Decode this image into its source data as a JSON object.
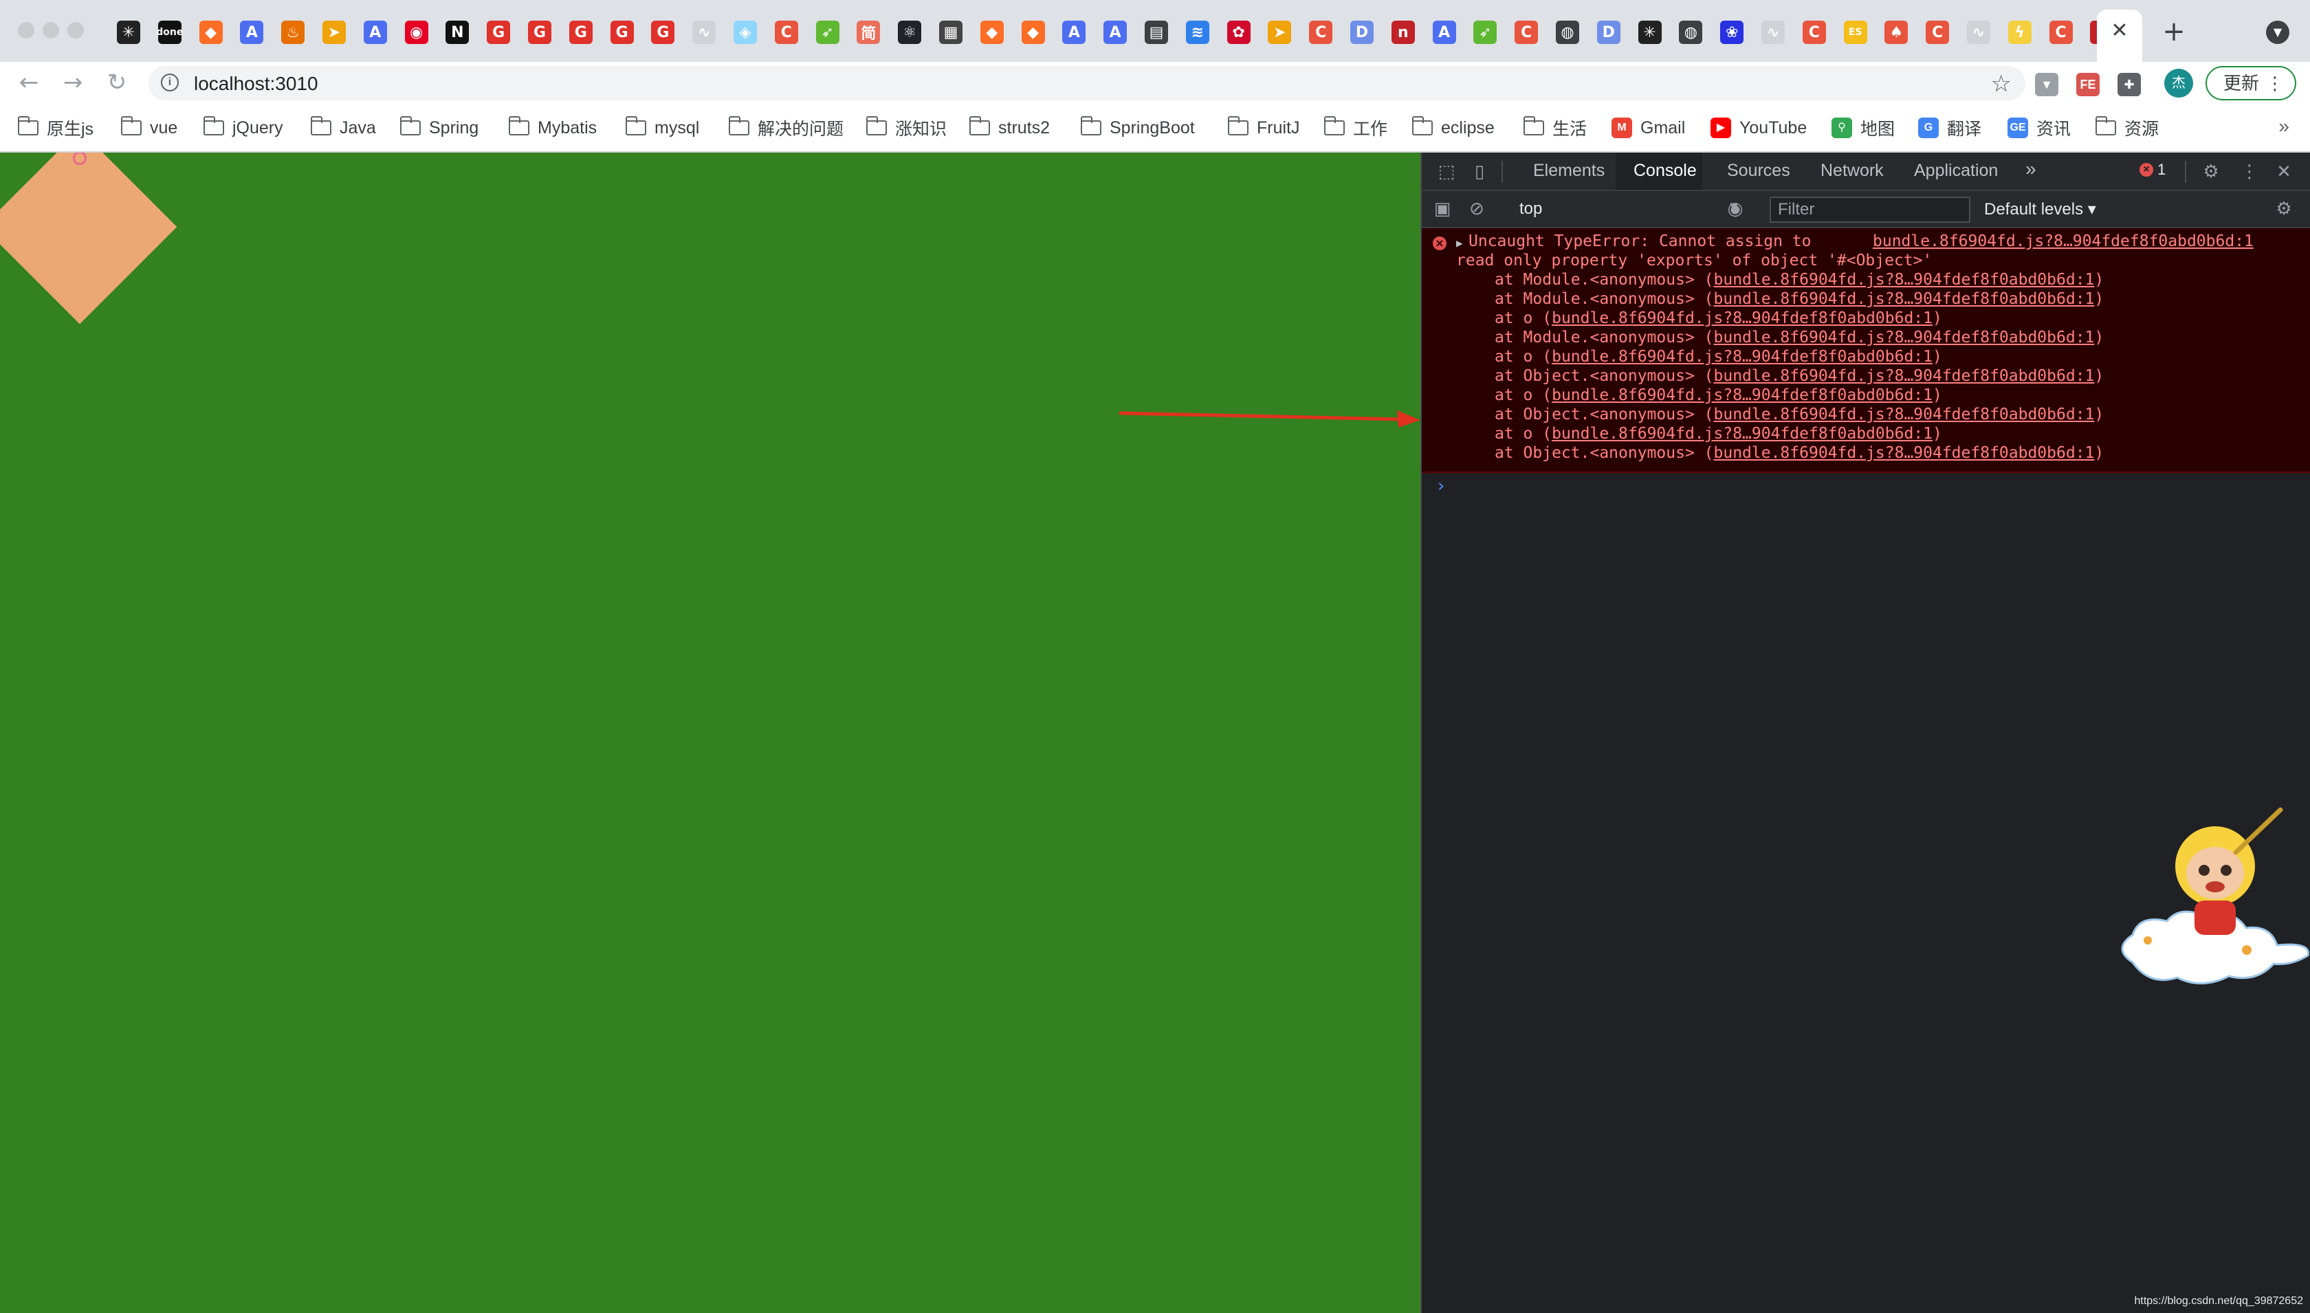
{
  "browser": {
    "url": "localhost:3010",
    "update_label": "更新",
    "avatar_label": "杰",
    "tab_close_glyph": "✕",
    "new_tab_glyph": "+",
    "tabs": [
      {
        "icon": "sunburst-icon",
        "glyph": "✳",
        "bg": "#222222"
      },
      {
        "icon": "done-icon",
        "glyph": "done",
        "bg": "#111111"
      },
      {
        "icon": "gitlab-icon",
        "glyph": "◆",
        "bg": "#fc6d26"
      },
      {
        "icon": "a-letter-icon",
        "glyph": "A",
        "bg": "#4e6ef2"
      },
      {
        "icon": "java-icon",
        "glyph": "♨",
        "bg": "#e76f00"
      },
      {
        "icon": "leaf-icon",
        "glyph": "➤",
        "bg": "#f0a30a"
      },
      {
        "icon": "a-letter-icon",
        "glyph": "A",
        "bg": "#4e6ef2"
      },
      {
        "icon": "netease-icon",
        "glyph": "◉",
        "bg": "#e60026"
      },
      {
        "icon": "n-letter-icon",
        "glyph": "N",
        "bg": "#111111"
      },
      {
        "icon": "g-icon",
        "glyph": "G",
        "bg": "#e0312b"
      },
      {
        "icon": "g-icon",
        "glyph": "G",
        "bg": "#e0312b"
      },
      {
        "icon": "g-icon",
        "glyph": "G",
        "bg": "#e0312b"
      },
      {
        "icon": "g-icon",
        "glyph": "G",
        "bg": "#e0312b"
      },
      {
        "icon": "g-icon",
        "glyph": "G",
        "bg": "#e0312b"
      },
      {
        "icon": "bird-icon",
        "glyph": "∿",
        "bg": "#cfd2d6"
      },
      {
        "icon": "webpack-icon",
        "glyph": "◈",
        "bg": "#8ed6fb"
      },
      {
        "icon": "c-letter-icon",
        "glyph": "C",
        "bg": "#e8543e"
      },
      {
        "icon": "leaf-icon",
        "glyph": "➶",
        "bg": "#5fb832"
      },
      {
        "icon": "jianshu-icon",
        "glyph": "简",
        "bg": "#ea6f5a"
      },
      {
        "icon": "react-icon",
        "glyph": "⚛",
        "bg": "#20232a"
      },
      {
        "icon": "grid-icon",
        "glyph": "▦",
        "bg": "#444444"
      },
      {
        "icon": "gitlab-icon",
        "glyph": "◆",
        "bg": "#fc6d26"
      },
      {
        "icon": "gitlab-icon",
        "glyph": "◆",
        "bg": "#fc6d26"
      },
      {
        "icon": "a-letter-icon",
        "glyph": "A",
        "bg": "#4e6ef2"
      },
      {
        "icon": "a-letter-icon",
        "glyph": "A",
        "bg": "#4e6ef2"
      },
      {
        "icon": "doc-icon",
        "glyph": "▤",
        "bg": "#3c4043"
      },
      {
        "icon": "layers-icon",
        "glyph": "≋",
        "bg": "#2f80ed"
      },
      {
        "icon": "huawei-icon",
        "glyph": "✿",
        "bg": "#cf0a2c"
      },
      {
        "icon": "leaf-icon",
        "glyph": "➤",
        "bg": "#f0a30a"
      },
      {
        "icon": "c-letter-icon",
        "glyph": "C",
        "bg": "#e8543e"
      },
      {
        "icon": "d-letter-icon",
        "glyph": "D",
        "bg": "#6f8ee8"
      },
      {
        "icon": "n-letter-icon",
        "glyph": "n",
        "bg": "#c12127"
      },
      {
        "icon": "a-letter-icon",
        "glyph": "A",
        "bg": "#4e6ef2"
      },
      {
        "icon": "leaf-icon",
        "glyph": "➶",
        "bg": "#5fb832"
      },
      {
        "icon": "c-letter-icon",
        "glyph": "C",
        "bg": "#e8543e"
      },
      {
        "icon": "globe-icon",
        "glyph": "◍",
        "bg": "#3c4043"
      },
      {
        "icon": "d-letter-icon",
        "glyph": "D",
        "bg": "#6f8ee8"
      },
      {
        "icon": "sunburst-icon",
        "glyph": "✳",
        "bg": "#222222"
      },
      {
        "icon": "globe-icon",
        "glyph": "◍",
        "bg": "#3c4043"
      },
      {
        "icon": "paw-icon",
        "glyph": "❀",
        "bg": "#2932e1"
      },
      {
        "icon": "bird-icon",
        "glyph": "∿",
        "bg": "#cfd2d6"
      },
      {
        "icon": "c-letter-icon",
        "glyph": "C",
        "bg": "#e8543e"
      },
      {
        "icon": "es-icon",
        "glyph": "ES",
        "bg": "#f4bd19"
      },
      {
        "icon": "fire-icon",
        "glyph": "♠",
        "bg": "#e8543e"
      },
      {
        "icon": "c-letter-icon",
        "glyph": "C",
        "bg": "#e8543e"
      },
      {
        "icon": "bird-icon",
        "glyph": "∿",
        "bg": "#cfd2d6"
      },
      {
        "icon": "bolt-icon",
        "glyph": "ϟ",
        "bg": "#f4d03f"
      },
      {
        "icon": "c-letter-icon",
        "glyph": "C",
        "bg": "#e8543e"
      },
      {
        "icon": "n-letter-icon",
        "glyph": "n",
        "bg": "#c12127"
      }
    ],
    "extensions": [
      {
        "icon": "vue-devtools-icon",
        "glyph": "▼",
        "bg": "#9aa0a6"
      },
      {
        "icon": "fe-helper-icon",
        "glyph": "FE",
        "bg": "#d9534f"
      },
      {
        "icon": "puzzle-icon",
        "glyph": "✚",
        "bg": "#5f6368"
      }
    ]
  },
  "bookmarks": [
    {
      "label": "原生js",
      "type": "folder"
    },
    {
      "label": "vue",
      "type": "folder"
    },
    {
      "label": "jQuery",
      "type": "folder"
    },
    {
      "label": "Java",
      "type": "folder"
    },
    {
      "label": "Spring",
      "type": "folder"
    },
    {
      "label": "Mybatis",
      "type": "folder"
    },
    {
      "label": "mysql",
      "type": "folder"
    },
    {
      "label": "解决的问题",
      "type": "folder"
    },
    {
      "label": "涨知识",
      "type": "folder"
    },
    {
      "label": "struts2",
      "type": "folder"
    },
    {
      "label": "SpringBoot",
      "type": "folder"
    },
    {
      "label": "FruitJ",
      "type": "folder"
    },
    {
      "label": "工作",
      "type": "folder"
    },
    {
      "label": "eclipse",
      "type": "folder"
    },
    {
      "label": "生活",
      "type": "folder"
    },
    {
      "label": "Gmail",
      "type": "site",
      "icon": "gmail-icon",
      "glyph": "M",
      "bg": "#ea4335"
    },
    {
      "label": "YouTube",
      "type": "site",
      "icon": "youtube-icon",
      "glyph": "▶",
      "bg": "#ff0000"
    },
    {
      "label": "地图",
      "type": "site",
      "icon": "maps-icon",
      "glyph": "⚲",
      "bg": "#34a853"
    },
    {
      "label": "翻译",
      "type": "site",
      "icon": "translate-icon",
      "glyph": "G",
      "bg": "#4285f4"
    },
    {
      "label": "资讯",
      "type": "site",
      "icon": "news-icon",
      "glyph": "GE",
      "bg": "#4285f4"
    },
    {
      "label": "资源",
      "type": "folder"
    }
  ],
  "bookmarks_more": "»",
  "devtools": {
    "tabs": [
      "Elements",
      "Console",
      "Sources",
      "Network",
      "Application"
    ],
    "active_tab": "Console",
    "more_tabs": "»",
    "error_count": "1",
    "context": "top",
    "filter_placeholder": "Filter",
    "levels": "Default levels ▾",
    "error": {
      "message_line1": "Uncaught TypeError: Cannot assign to",
      "message_line2": "read only property 'exports' of object '#<Object>'",
      "source": "bundle.8f6904fd.js?8…904fdef8f0abd0b6d:1",
      "stack": [
        {
          "prefix": "at Module.<anonymous> (",
          "link": "bundle.8f6904fd.js?8…904fdef8f0abd0b6d:1",
          "suffix": ")"
        },
        {
          "prefix": "at Module.<anonymous> (",
          "link": "bundle.8f6904fd.js?8…904fdef8f0abd0b6d:1",
          "suffix": ")"
        },
        {
          "prefix": "at o (",
          "link": "bundle.8f6904fd.js?8…904fdef8f0abd0b6d:1",
          "suffix": ")"
        },
        {
          "prefix": "at Module.<anonymous> (",
          "link": "bundle.8f6904fd.js?8…904fdef8f0abd0b6d:1",
          "suffix": ")"
        },
        {
          "prefix": "at o (",
          "link": "bundle.8f6904fd.js?8…904fdef8f0abd0b6d:1",
          "suffix": ")"
        },
        {
          "prefix": "at Object.<anonymous> (",
          "link": "bundle.8f6904fd.js?8…904fdef8f0abd0b6d:1",
          "suffix": ")"
        },
        {
          "prefix": "at o (",
          "link": "bundle.8f6904fd.js?8…904fdef8f0abd0b6d:1",
          "suffix": ")"
        },
        {
          "prefix": "at Object.<anonymous> (",
          "link": "bundle.8f6904fd.js?8…904fdef8f0abd0b6d:1",
          "suffix": ")"
        },
        {
          "prefix": "at o (",
          "link": "bundle.8f6904fd.js?8…904fdef8f0abd0b6d:1",
          "suffix": ")"
        },
        {
          "prefix": "at Object.<anonymous> (",
          "link": "bundle.8f6904fd.js?8…904fdef8f0abd0b6d:1",
          "suffix": ")"
        }
      ]
    },
    "prompt": "›"
  },
  "watermark": "https://blog.csdn.net/qq_39872652",
  "colors": {
    "page_background": "#338120",
    "diamond": "#eca872",
    "annotation_arrow": "#e0321e",
    "console_error_bg": "#290000",
    "console_error_text": "#ff8080"
  }
}
